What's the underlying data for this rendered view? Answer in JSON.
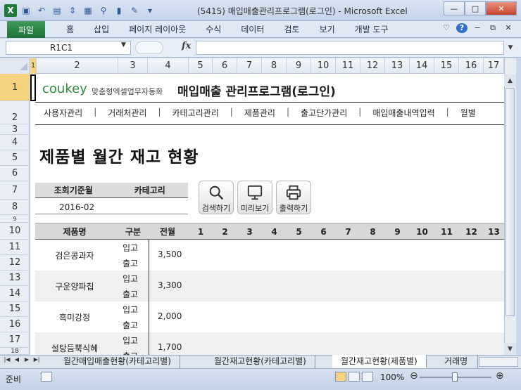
{
  "window": {
    "title": "(5415) 매입매출관리프로그램(로그인) - Microsoft Excel"
  },
  "ribbon": {
    "file_tab": "파일",
    "tabs": [
      "홈",
      "삽입",
      "페이지 레이아웃",
      "수식",
      "데이터",
      "검토",
      "보기",
      "개발 도구"
    ]
  },
  "formula_bar": {
    "name_box": "R1C1",
    "fx": "fx",
    "formula": ""
  },
  "columns": [
    "1",
    "2",
    "3",
    "4",
    "5",
    "6",
    "7",
    "8",
    "9",
    "10",
    "11",
    "12",
    "13",
    "14",
    "15",
    "16",
    "17"
  ],
  "rows": [
    "1",
    "2",
    "3",
    "4",
    "5",
    "6",
    "7",
    "8",
    "9",
    "10",
    "11",
    "12",
    "13",
    "14",
    "15",
    "16",
    "17",
    "18"
  ],
  "sheet": {
    "logo_brand": "coukey",
    "logo_tagline": "맞춤형엑셀업무자동화",
    "app_title": "매입매출 관리프로그램(로그인)",
    "nav": [
      "사용자관리",
      "거래처관리",
      "카테고리관리",
      "제품관리",
      "출고단가관리",
      "매입매출내역입력",
      "월별"
    ],
    "page_title": "제품별 월간 재고 현황",
    "filter": {
      "date_label": "조회기준월",
      "category_label": "카테고리",
      "date_value": "2016-02",
      "category_value": ""
    },
    "buttons": {
      "search": "검색하기",
      "preview": "미리보기",
      "print": "출력하기"
    },
    "table": {
      "headers": [
        "제품명",
        "구분",
        "전월",
        "1",
        "2",
        "3",
        "4",
        "5",
        "6",
        "7",
        "8",
        "9",
        "10",
        "11",
        "12",
        "13"
      ],
      "in_label": "입고",
      "out_label": "출고",
      "rows": [
        {
          "name": "검은콩과자",
          "prev": "3,500"
        },
        {
          "name": "구운양파칩",
          "prev": "3,300"
        },
        {
          "name": "흑미강정",
          "prev": "2,000"
        },
        {
          "name": "설탕듬뿍식혜",
          "prev": "1,700"
        }
      ]
    }
  },
  "sheet_tabs": [
    "월간매입매출현황(카테고리별)",
    "월간재고현황(카테고리별)",
    "월간재고현황(제품별)",
    "거래명"
  ],
  "status": {
    "mode": "준비",
    "zoom": "100%"
  }
}
